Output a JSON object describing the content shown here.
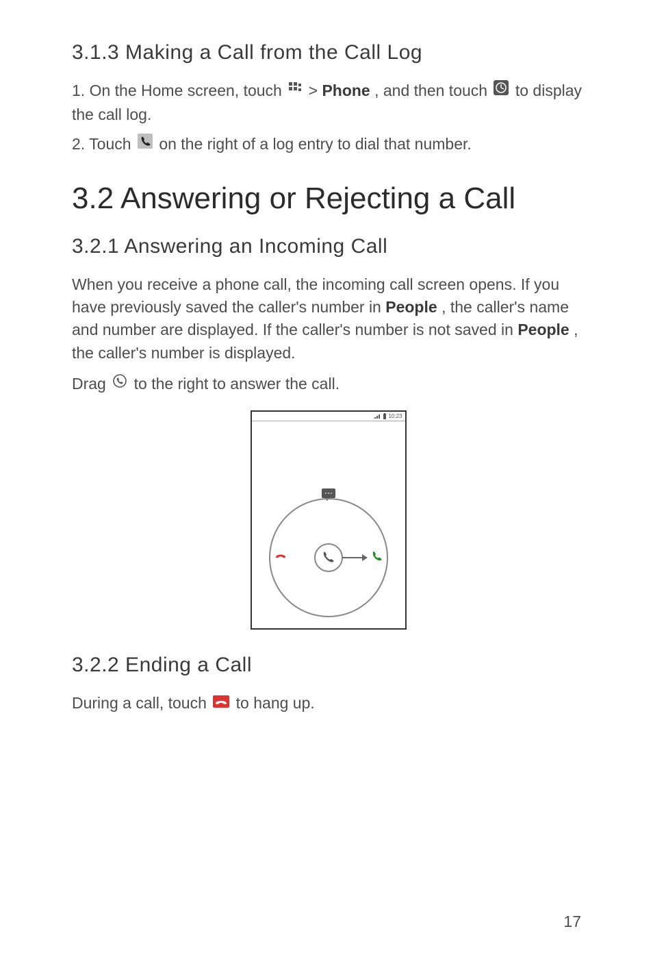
{
  "section313": {
    "heading": "3.1.3  Making a Call from the Call Log",
    "step1_a": "1. On the Home screen, touch ",
    "step1_b": "  > ",
    "step1_phone": "Phone",
    "step1_c": ", and then touch ",
    "step1_d": "  to display the call log.",
    "step2_a": "2. Touch ",
    "step2_b": "  on the right of a log entry to dial that number."
  },
  "section32": {
    "heading": "3.2  Answering or Rejecting a Call"
  },
  "section321": {
    "heading": "3.2.1  Answering an Incoming Call",
    "para_a": "When you receive a phone call, the incoming call screen opens. If you have previously saved the caller's number in ",
    "people": "People",
    "para_b": ", the caller's name and number are displayed. If the caller's number is not saved in ",
    "para_c": ", the caller's number is displayed.",
    "drag_a": "Drag ",
    "drag_b": "  to the right to answer the call."
  },
  "section322": {
    "heading": "3.2.2  Ending a Call",
    "para_a": "During a call, touch ",
    "para_b": "  to hang up."
  },
  "statusbar_time": "10:23",
  "page_number": "17"
}
